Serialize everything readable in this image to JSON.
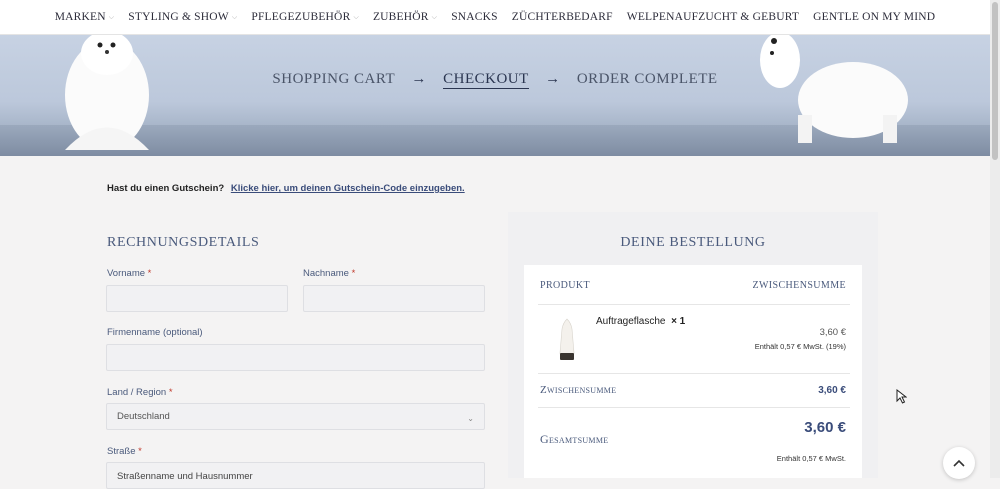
{
  "nav": {
    "items": [
      {
        "label": "MARKEN",
        "dropdown": true
      },
      {
        "label": "STYLING & SHOW",
        "dropdown": true
      },
      {
        "label": "PFLEGEZUBEHÖR",
        "dropdown": true
      },
      {
        "label": "ZUBEHÖR",
        "dropdown": true
      },
      {
        "label": "SNACKS",
        "dropdown": false
      },
      {
        "label": "ZÜCHTERBEDARF",
        "dropdown": false
      },
      {
        "label": "WELPENAUFZUCHT & GEBURT",
        "dropdown": false
      },
      {
        "label": "GENTLE ON MY MIND",
        "dropdown": false
      }
    ]
  },
  "steps": {
    "cart": "SHOPPING CART",
    "checkout": "CHECKOUT",
    "complete": "ORDER COMPLETE",
    "arrow": "→"
  },
  "coupon": {
    "question": "Hast du einen Gutschein?",
    "link": "Klicke hier, um deinen Gutschein-Code einzugeben."
  },
  "billing": {
    "title": "RECHNUNGSDETAILS",
    "first_name_label": "Vorname",
    "last_name_label": "Nachname",
    "company_label": "Firmenname (optional)",
    "country_label": "Land / Region",
    "country_value": "Deutschland",
    "street_label": "Straße",
    "street_placeholder": "Straßenname und Hausnummer",
    "required_mark": "*"
  },
  "order": {
    "title": "DEINE BESTELLUNG",
    "col_product": "PRODUKT",
    "col_subtotal": "ZWISCHENSUMME",
    "item_name": "Auftrageflasche",
    "item_qty": "× 1",
    "item_price": "3,60 €",
    "item_tax": "Enthält 0,57 € MwSt. (19%)",
    "subtotal_label": "Zwischensumme",
    "subtotal_value": "3,60 €",
    "total_label": "Gesamtsumme",
    "total_value": "3,60 €",
    "total_tax": "Enthält 0,57 € MwSt."
  },
  "colors": {
    "accent": "#3a4c7a",
    "heading": "#4a5a7c"
  }
}
